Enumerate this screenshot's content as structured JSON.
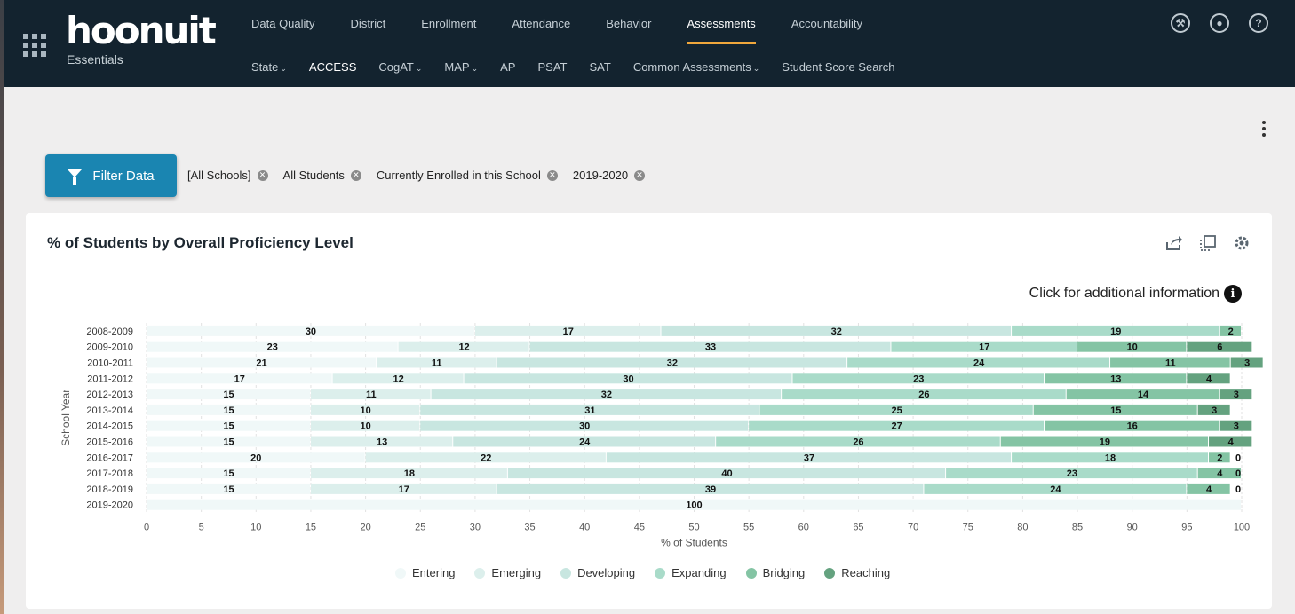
{
  "app": {
    "logo": "hoonuit",
    "logo_sub": "Essentials"
  },
  "nav": {
    "tabs": [
      "Data Quality",
      "District",
      "Enrollment",
      "Attendance",
      "Behavior",
      "Assessments",
      "Accountability"
    ],
    "active_tab": "Assessments",
    "subtabs": [
      {
        "label": "State",
        "dropdown": true
      },
      {
        "label": "ACCESS",
        "dropdown": false,
        "active": true
      },
      {
        "label": "CogAT",
        "dropdown": true
      },
      {
        "label": "MAP",
        "dropdown": true
      },
      {
        "label": "AP",
        "dropdown": false
      },
      {
        "label": "PSAT",
        "dropdown": false
      },
      {
        "label": "SAT",
        "dropdown": false
      },
      {
        "label": "Common Assessments",
        "dropdown": true
      },
      {
        "label": "Student Score Search",
        "dropdown": false
      }
    ],
    "icons": [
      "tools-icon",
      "user-icon",
      "help-icon"
    ]
  },
  "filters": {
    "button_label": "Filter Data",
    "chips": [
      "[All Schools]",
      "All Students",
      "Currently Enrolled in this School",
      "2019-2020"
    ]
  },
  "card": {
    "title": "% of Students by Overall Proficiency Level",
    "info_link": "Click for additional information"
  },
  "chart_data": {
    "type": "bar",
    "orientation": "horizontal",
    "stacked": true,
    "xlabel": "% of Students",
    "ylabel": "School Year",
    "xlim": [
      0,
      100
    ],
    "xticks": [
      0,
      5,
      10,
      15,
      20,
      25,
      30,
      35,
      40,
      45,
      50,
      55,
      60,
      65,
      70,
      75,
      80,
      85,
      90,
      95,
      100
    ],
    "categories": [
      "2008-2009",
      "2009-2010",
      "2010-2011",
      "2011-2012",
      "2012-2013",
      "2013-2014",
      "2014-2015",
      "2015-2016",
      "2016-2017",
      "2017-2018",
      "2018-2019",
      "2019-2020"
    ],
    "series": [
      {
        "name": "Entering",
        "color": "#f0f8f8",
        "values": [
          30,
          23,
          21,
          17,
          15,
          15,
          15,
          15,
          20,
          15,
          15,
          100
        ]
      },
      {
        "name": "Emerging",
        "color": "#dcefec",
        "values": [
          17,
          12,
          11,
          12,
          11,
          10,
          10,
          13,
          22,
          18,
          17,
          null
        ]
      },
      {
        "name": "Developing",
        "color": "#c8e6e0",
        "values": [
          32,
          33,
          32,
          30,
          32,
          31,
          30,
          24,
          37,
          40,
          39,
          null
        ]
      },
      {
        "name": "Expanding",
        "color": "#a9dbc9",
        "values": [
          19,
          17,
          24,
          23,
          26,
          25,
          27,
          26,
          18,
          23,
          24,
          null
        ]
      },
      {
        "name": "Bridging",
        "color": "#84c4a4",
        "values": [
          2,
          10,
          11,
          13,
          14,
          15,
          16,
          19,
          2,
          4,
          4,
          null
        ]
      },
      {
        "name": "Reaching",
        "color": "#64a27f",
        "values": [
          null,
          6,
          3,
          4,
          3,
          3,
          3,
          4,
          0,
          0,
          0,
          null
        ]
      }
    ],
    "grid": true,
    "legend_position": "bottom"
  }
}
